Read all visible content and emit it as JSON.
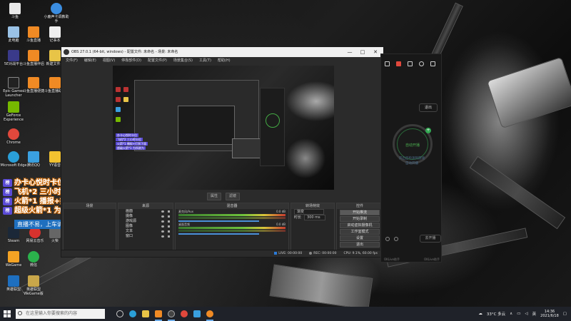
{
  "desktop_icons": [
    {
      "label": "斗鱼",
      "color": "#e8e8e8"
    },
    {
      "label": "小鹿声卡调教助手",
      "color": "#3b8de0"
    },
    {
      "label": "此电脑",
      "color": "#9ac2e6"
    },
    {
      "label": "斗鱼直播",
      "color": "#f08a24"
    },
    {
      "label": "记事本",
      "color": "#f0f0f0"
    },
    {
      "label": "5E对战平台",
      "color": "#3a3a8a"
    },
    {
      "label": "斗鱼直播伴侣",
      "color": "#f08a24"
    },
    {
      "label": "新建文件夹",
      "color": "#e8c447"
    },
    {
      "label": "Epic Games Launcher",
      "color": "#222"
    },
    {
      "label": "斗鱼直播便捷",
      "color": "#f08a24"
    },
    {
      "label": "斗鱼直播助手",
      "color": "#f08a24"
    },
    {
      "label": "GeForce Experience",
      "color": "#76b900"
    },
    {
      "label": "Chrome",
      "color": "#e0483c"
    },
    {
      "label": "Microsoft Edge",
      "color": "#2a9fd8"
    },
    {
      "label": "腾讯QQ",
      "color": "#3aa0e0"
    },
    {
      "label": "YY语音",
      "color": "#f2c230"
    },
    {
      "label": "Steam",
      "color": "#1b2838"
    },
    {
      "label": "网易云音乐",
      "color": "#d8322e"
    },
    {
      "label": "火柴",
      "color": "#666"
    },
    {
      "label": "WeGame",
      "color": "#f4a324"
    },
    {
      "label": "微信",
      "color": "#2bb24c"
    },
    {
      "label": "英雄联盟",
      "color": "#1e6fbf"
    },
    {
      "label": "英雄联盟WeGame版",
      "color": "#c9a74a"
    }
  ],
  "overlay": {
    "lines": [
      "办卡心悦时卡位",
      "飞机*2 三小时卡位",
      "火箭*1 播报+打到下面",
      "超级火箭*1 为所欲为"
    ],
    "badge": "榜",
    "footer": "直播不易，上车请稳定"
  },
  "obs": {
    "title": "OBS 27.0.1 (64-bit, windows) - 配置文件: 未命名 - 场景: 未命名",
    "menu": [
      "文件(F)",
      "编辑(E)",
      "视图(V)",
      "停靠部件(D)",
      "配置文件(P)",
      "场景集合(S)",
      "工具(T)",
      "帮助(H)"
    ],
    "preview_controls": [
      "属性",
      "滤镜"
    ],
    "docks": {
      "scenes_header": "场景",
      "sources_header": "来源",
      "sources": [
        "画面",
        "摄像",
        "游戏源",
        "图像",
        "文本",
        "窗口"
      ],
      "mixer_header": "混音器",
      "mixer": [
        {
          "name": "麦克风/Aux",
          "value": "0.0 dB"
        },
        {
          "name": "桌面音频",
          "value": "0.0 dB"
        }
      ],
      "transitions_header": "转场特效",
      "transition_type": "渐变",
      "duration_label": "时长",
      "duration_value": "300 ms",
      "controls_header": "控件",
      "controls": [
        "开始推流",
        "开始录制",
        "启动虚拟摄像机",
        "工作室模式",
        "设置",
        "退出"
      ]
    },
    "status": {
      "live": "LIVE: 00:00:00",
      "rec": "REC: 00:00:00",
      "cpu": "CPU: 9.1%, 60.00 fps"
    }
  },
  "panel": {
    "exit": "退出",
    "circle": "自动开播",
    "plus": "+",
    "hint1": "开启后检测到游戏",
    "hint2": "自动开播",
    "button": "去开播",
    "foot_left": "OKLive助手",
    "foot_right": "OKLive助手"
  },
  "taskbar": {
    "search_placeholder": "在这里输入你要搜索的内容",
    "apps": [
      {
        "name": "task-view",
        "color": "#ccc"
      },
      {
        "name": "edge",
        "color": "#2a9fd8"
      },
      {
        "name": "file-explorer",
        "color": "#e8c447"
      },
      {
        "name": "douyu",
        "color": "#f08a24"
      },
      {
        "name": "obs",
        "color": "#444"
      },
      {
        "name": "chrome",
        "color": "#e0483c"
      },
      {
        "name": "qq",
        "color": "#3aa0e0"
      },
      {
        "name": "douyu-live",
        "color": "#f08a24"
      }
    ],
    "weather": "33°C 多云",
    "time": "14:36",
    "date": "2021/6/18"
  }
}
